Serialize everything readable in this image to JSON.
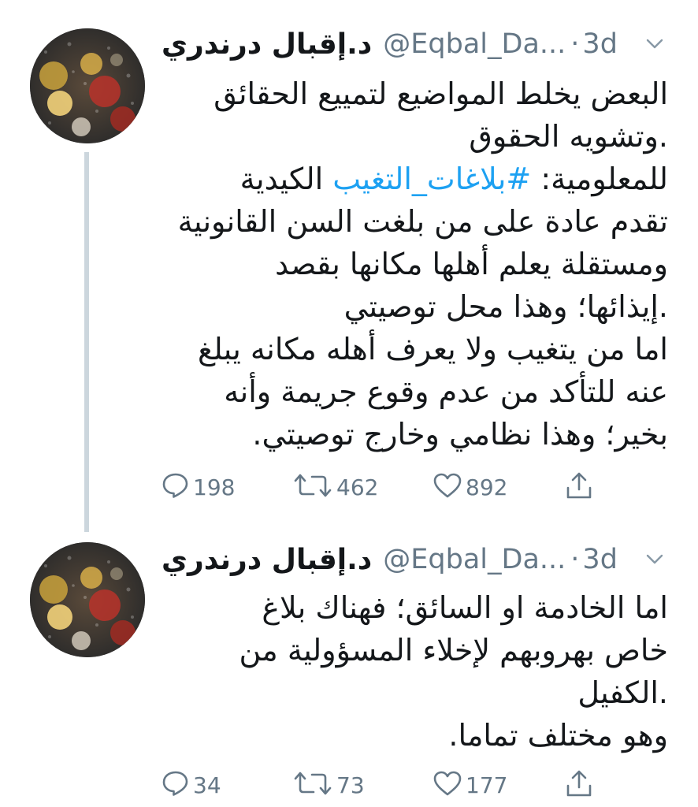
{
  "tweets": [
    {
      "display_name": "د.إقبال درندري",
      "handle": "@Eqbal_Da...",
      "separator": "·",
      "time": "3d",
      "lines": [
        "البعض يخلط المواضيع لتمييع الحقائق",
        ".وتشويه الحقوق",
        "",
        "تقدم عادة على من بلغت السن القانونية",
        "ومستقلة يعلم أهلها مكانها بقصد",
        ".إيذائها؛ وهذا محل توصيتي",
        "اما من يتغيب ولا يعرف أهله مكانه يبلغ",
        "عنه للتأكد من عدم وقوع جريمة وأنه",
        "بخير؛ وهذا نظامي وخارج توصيتي."
      ],
      "hashtag_line": {
        "before": "للمعلومية: ",
        "hashtag": "#بلاغات_التغيب",
        "after": " الكيدية"
      },
      "replies": "198",
      "retweets": "462",
      "likes": "892"
    },
    {
      "display_name": "د.إقبال درندري",
      "handle": "@Eqbal_Da...",
      "separator": "·",
      "time": "3d",
      "lines": [
        "اما الخادمة او السائق؛ فهناك بلاغ",
        "خاص بهروبهم لإخلاء المسؤولية من",
        ".الكفيل",
        "وهو مختلف تماما."
      ],
      "replies": "34",
      "retweets": "73",
      "likes": "177"
    }
  ],
  "icons": {
    "reply": "reply-icon",
    "retweet": "retweet-icon",
    "like": "heart-icon",
    "share": "share-icon",
    "menu": "chevron-down-icon"
  },
  "colors": {
    "text": "#14171a",
    "secondary": "#657786",
    "link": "#1da1f2",
    "thread_line": "#ccd6dd"
  }
}
